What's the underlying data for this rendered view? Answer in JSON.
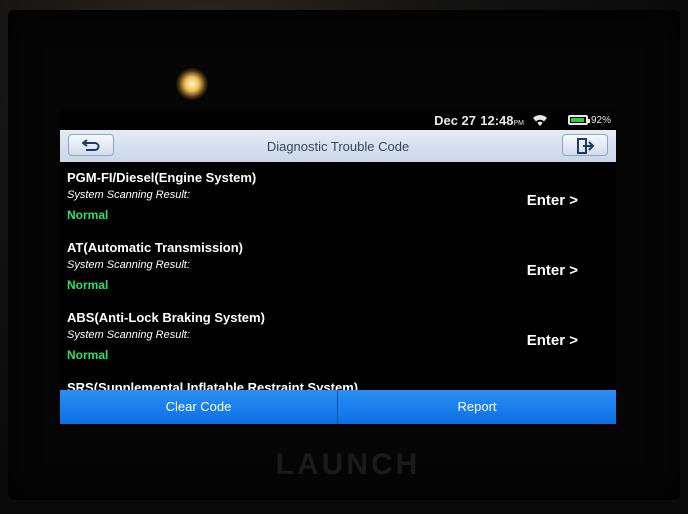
{
  "status_bar": {
    "date": "Dec 27",
    "time": "12:48",
    "ampm": "PM",
    "battery_percent": "92%",
    "battery_level": 0.92
  },
  "header": {
    "title": "Diagnostic Trouble Code",
    "back_icon": "back-arrow-icon",
    "exit_icon": "exit-icon"
  },
  "systems": [
    {
      "name": "PGM-FI/Diesel(Engine System)",
      "scan_label": "System Scanning Result:",
      "result": "Normal",
      "action": "Enter >"
    },
    {
      "name": "AT(Automatic Transmission)",
      "scan_label": "System Scanning Result:",
      "result": "Normal",
      "action": "Enter >"
    },
    {
      "name": "ABS(Anti-Lock Braking System)",
      "scan_label": "System Scanning Result:",
      "result": "Normal",
      "action": "Enter >"
    },
    {
      "name": "SRS(Supplemental Inflatable Restraint System)"
    }
  ],
  "footer": {
    "clear_label": "Clear Code",
    "report_label": "Report"
  },
  "device": {
    "brand": "LAUNCH"
  },
  "colors": {
    "accent": "#0b6fe4",
    "status_ok": "#2ee06a",
    "header_bg": "#d6e2f0"
  }
}
